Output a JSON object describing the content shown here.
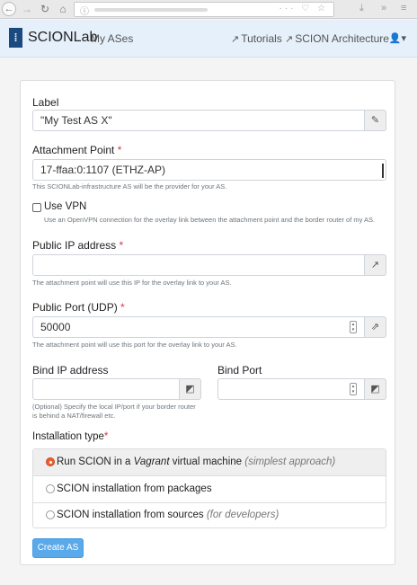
{
  "browser": {
    "nav": {
      "back": "←",
      "forward": "→",
      "reload": "↻",
      "home": "⌂"
    },
    "url_info_icon": "ⓘ",
    "url_controls": "··· ♡ ☆",
    "toolbar_icons": {
      "download": "⤓",
      "more": "»",
      "menu": "≡"
    }
  },
  "navbar": {
    "logo_glyph": "⁞",
    "brand": "SCIONLab",
    "my_ases": "My ASes",
    "tutorials": "Tutorials",
    "architecture": "SCION Architecture",
    "external_icon": "↗",
    "user_icon": "👤▾"
  },
  "form": {
    "label": {
      "title": "Label",
      "value": "\"My Test AS X\"",
      "edit_icon": "✎"
    },
    "attachment_point": {
      "title": "Attachment Point",
      "required_mark": "*",
      "selected": "17-ffaa:0:1107 (ETHZ-AP)",
      "help": "This SCIONLab-infrastructure AS will be the provider for your AS."
    },
    "use_vpn": {
      "label": "Use VPN",
      "help": "Use an OpenVPN connection for the overlay link between the attachment point and the border router of my AS."
    },
    "public_ip": {
      "title": "Public IP address",
      "required_mark": "*",
      "value": "",
      "addon_icon": "↗",
      "help": "The attachment point will use this IP for the overlay link to your AS."
    },
    "public_port": {
      "title": "Public Port (UDP)",
      "required_mark": "*",
      "value": "50000",
      "addon_icon": "⇗",
      "help": "The attachment point will use this port for the overlay link to your AS."
    },
    "bind_ip": {
      "title": "Bind IP address",
      "value": "",
      "addon_icon": "◩"
    },
    "bind_port": {
      "title": "Bind Port",
      "value": "",
      "addon_icon": "◩"
    },
    "bind_help_1": "(Optional) Specify the local IP/port if your border router",
    "bind_help_2": "is behind a NAT/firewall etc.",
    "installation_type": {
      "title": "Installation type",
      "required_mark": "*",
      "options": [
        {
          "pre": "Run SCION in a ",
          "em": "Vagrant",
          "post": " virtual machine ",
          "note": "(simplest approach)",
          "selected": true
        },
        {
          "pre": "SCION installation from packages",
          "em": "",
          "post": "",
          "note": "",
          "selected": false
        },
        {
          "pre": "SCION installation from sources ",
          "em": "",
          "post": "",
          "note": "(for developers)",
          "selected": false
        }
      ]
    },
    "submit": "Create AS"
  },
  "colors": {
    "accent": "#5aa9ea",
    "navbar_bg": "#e6f0fa",
    "radio_selected": "#e8612e"
  }
}
